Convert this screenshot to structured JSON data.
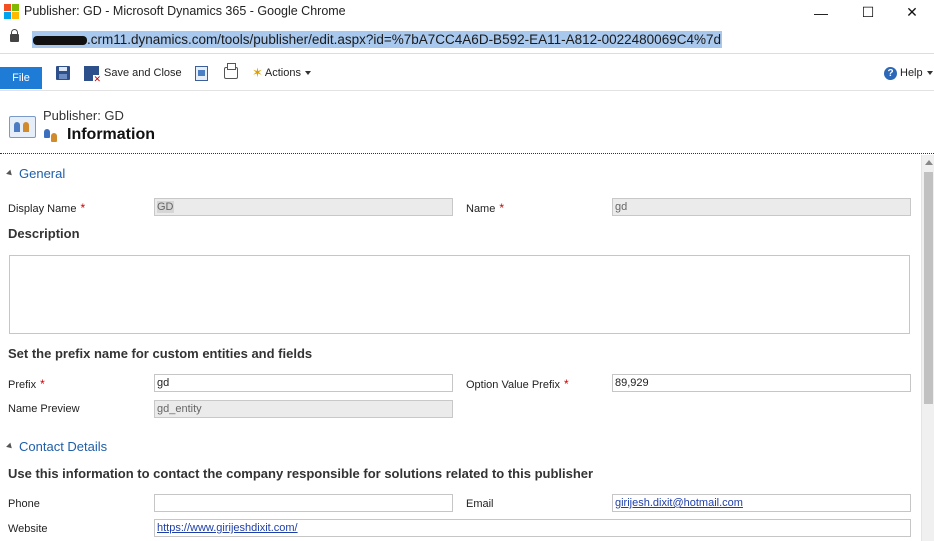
{
  "window": {
    "title": "Publisher: GD - Microsoft Dynamics 365 - Google Chrome",
    "minimize": "—",
    "maximize": "☐",
    "close": "✕"
  },
  "address": {
    "url_visible": ".crm11.dynamics.com/tools/publisher/edit.aspx?id=%7bA7CC4A6D-B592-EA11-A812-0022480069C4%7d"
  },
  "toolbar": {
    "file_label": "File",
    "save_close_label": "Save and Close",
    "actions_label": "Actions",
    "help_label": "Help",
    "help_icon": "?"
  },
  "header": {
    "entity_label": "Publisher: GD",
    "form_title": "Information"
  },
  "sections": {
    "general": {
      "title": "General",
      "display_name_label": "Display Name",
      "display_name_value": "GD",
      "name_label": "Name",
      "name_value": "gd",
      "description_label": "Description",
      "description_value": "",
      "prefix_heading": "Set the prefix name for custom entities and fields",
      "prefix_label": "Prefix",
      "prefix_value": "gd",
      "option_prefix_label": "Option Value Prefix",
      "option_prefix_value": "89,929",
      "name_preview_label": "Name Preview",
      "name_preview_value": "gd_entity"
    },
    "contact": {
      "title": "Contact Details",
      "intro": "Use this information to contact the company responsible for solutions related to this publisher",
      "phone_label": "Phone",
      "phone_value": "",
      "email_label": "Email",
      "email_value": "girijesh.dixit@hotmail.com",
      "website_label": "Website",
      "website_value": "https://www.girijeshdixit.com/"
    }
  },
  "required_marker": "*"
}
